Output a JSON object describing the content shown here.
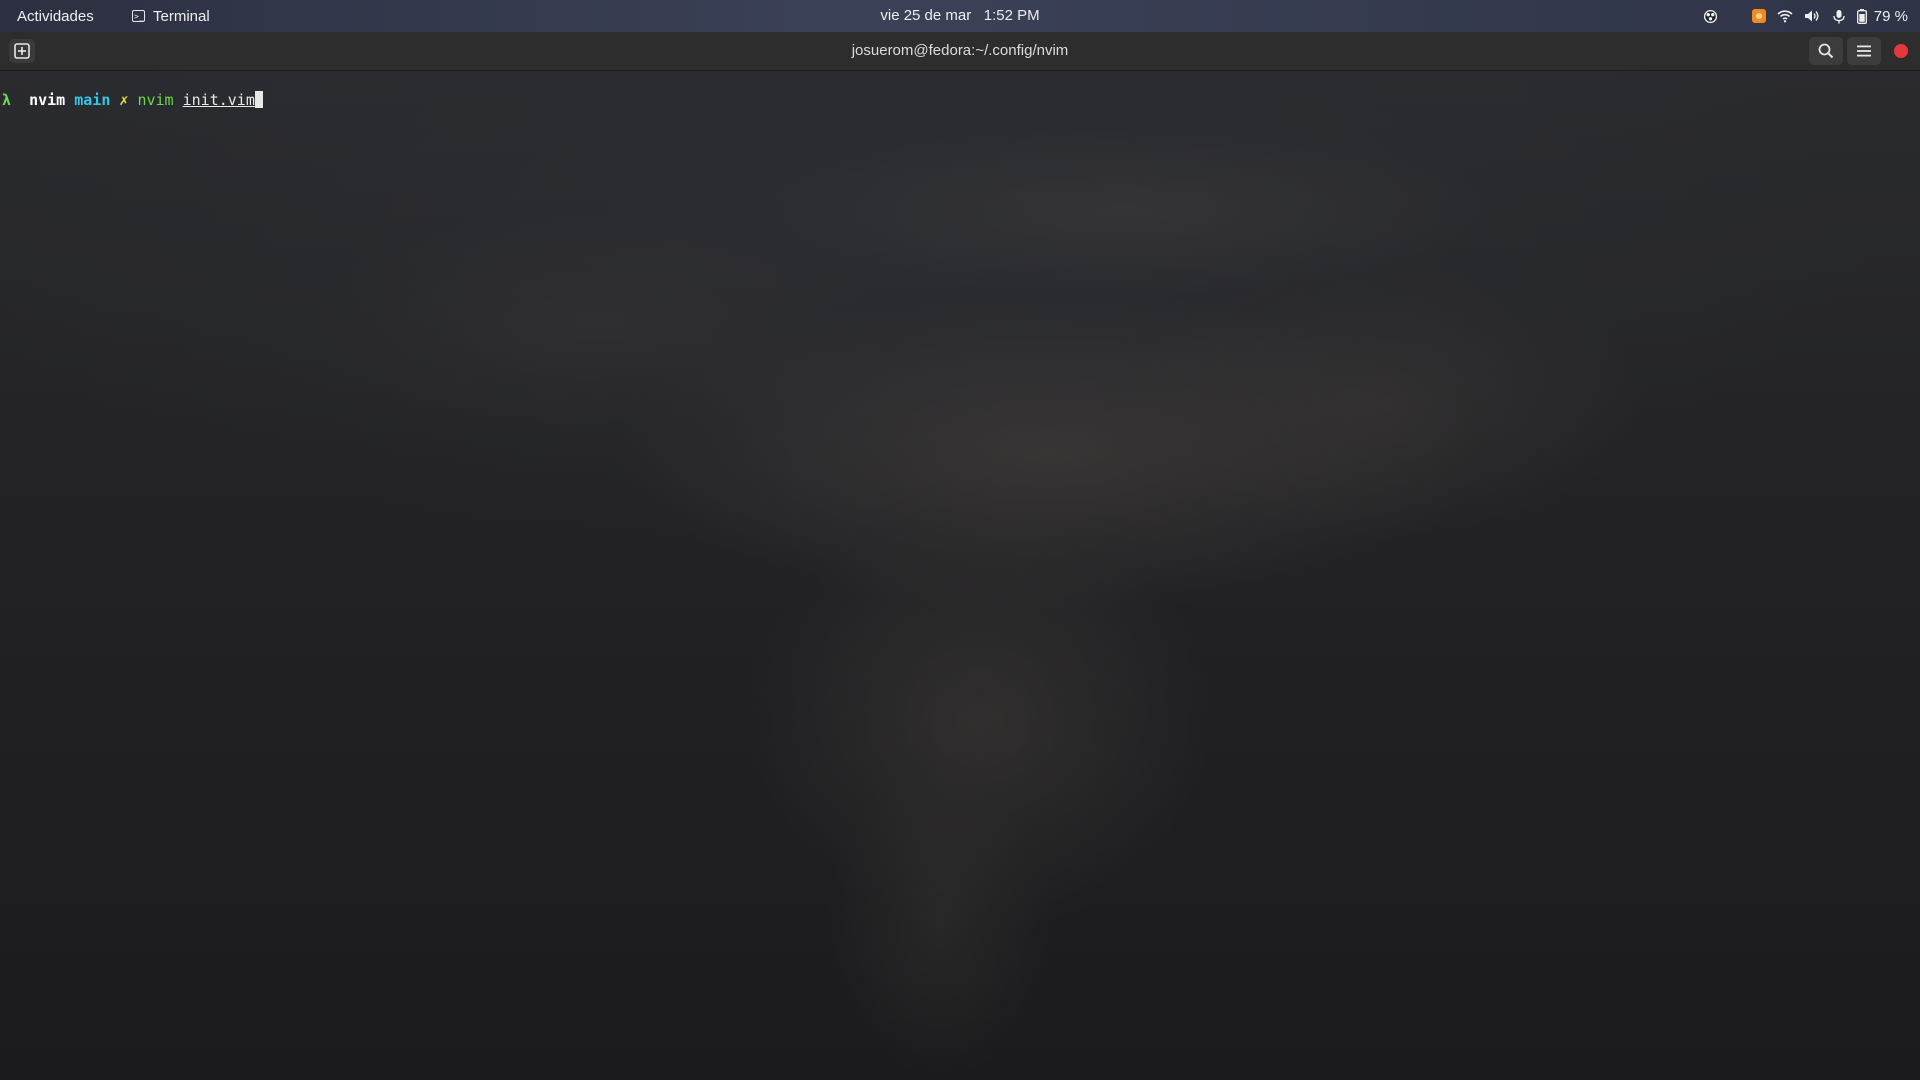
{
  "topbar": {
    "activities_label": "Actividades",
    "app_menu_label": "Terminal",
    "app_menu_icon": "terminal-icon",
    "date": "vie 25 de mar",
    "time": "1:52 PM",
    "tray": {
      "icons": [
        "obs-icon",
        "update-notifier-icon",
        "wifi-icon",
        "volume-icon",
        "microphone-icon",
        "battery-icon"
      ],
      "battery_label": "79 %"
    }
  },
  "window": {
    "title": "josuerom@fedora:~/.config/nvim",
    "buttons": {
      "new_tab_icon": "new-tab-icon",
      "search_icon": "search-icon",
      "menu_icon": "hamburger-menu-icon",
      "close_icon": "close-icon"
    },
    "colors": {
      "headerbar": "#2d2d2d",
      "close": "#e5383b"
    }
  },
  "terminal": {
    "prompt": {
      "lambda": "λ",
      "directory": "nvim",
      "branch": "main",
      "dirty_mark": "✗",
      "command": "nvim",
      "argument": "init.vim"
    },
    "colors": {
      "lambda": "#6cd84a",
      "branch": "#35c6e6",
      "dirty": "#e8e23a"
    }
  }
}
